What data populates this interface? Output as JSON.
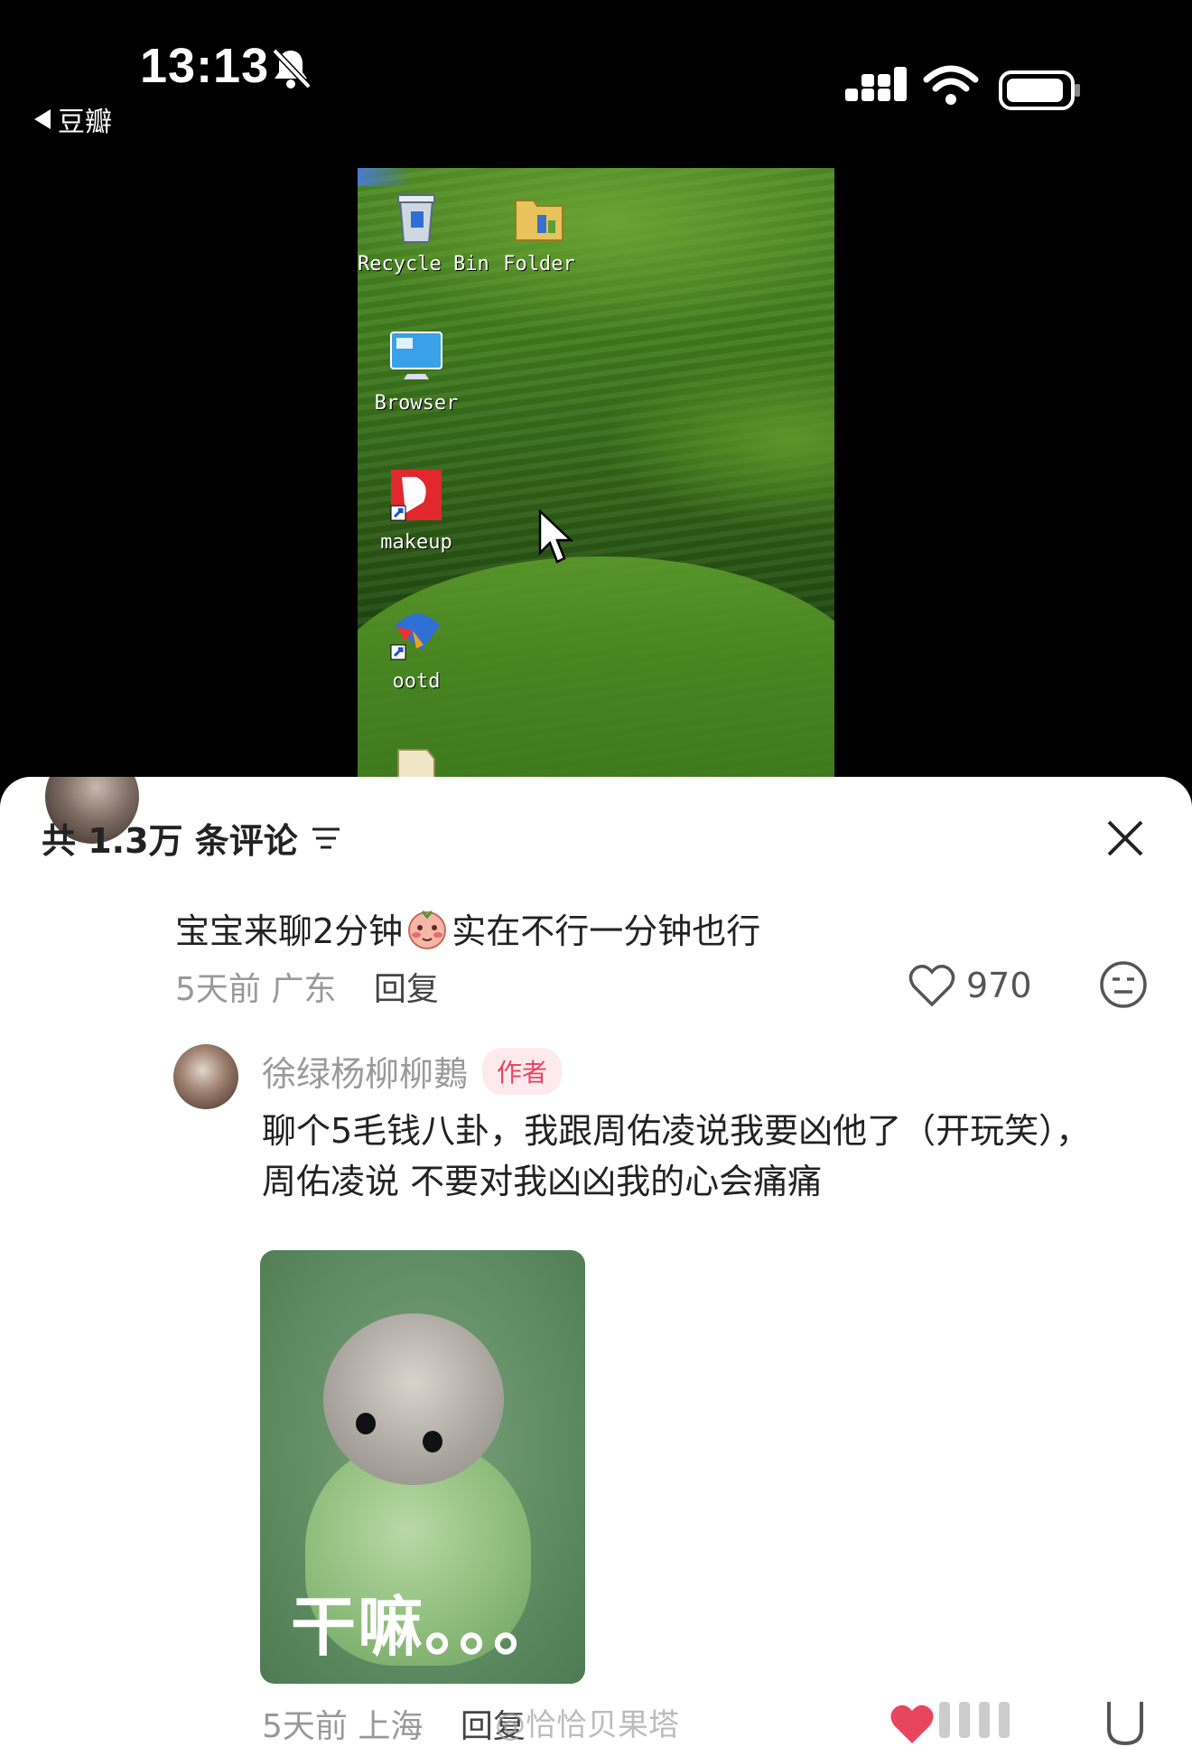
{
  "status": {
    "time": "13:13",
    "back_label": "豆瓣"
  },
  "desktop": {
    "icons": [
      {
        "label": "Recycle Bin",
        "icon": "recycle-bin-icon"
      },
      {
        "label": "Folder",
        "icon": "folder-icon"
      },
      {
        "label": "Browser",
        "icon": "browser-icon"
      },
      {
        "label": "makeup",
        "icon": "makeup-app-icon"
      },
      {
        "label": "ootd",
        "icon": "ootd-app-icon"
      }
    ]
  },
  "comments_sheet": {
    "header": "共 1.3万 条评论",
    "comment": {
      "text_before": "宝宝来聊2分钟",
      "text_after": "实在不行一分钟也行",
      "time": "5天前",
      "location": "广东",
      "reply_label": "回复",
      "likes": "970"
    },
    "reply": {
      "username": "徐绿杨柳柳鶈",
      "badge": "作者",
      "text": "聊个5毛钱八卦，我跟周佑凌说我要凶他了（开玩笑），周佑凌说 不要对我凶凶我的心会痛痛",
      "sticker_text": "干嘛。。。",
      "time": "5天前",
      "location": "上海",
      "reply_label": "回复",
      "watermark": "@恰恰贝果塔"
    }
  },
  "colors": {
    "author_badge": "#e8455f",
    "like_heart_active": "#e8455f"
  }
}
